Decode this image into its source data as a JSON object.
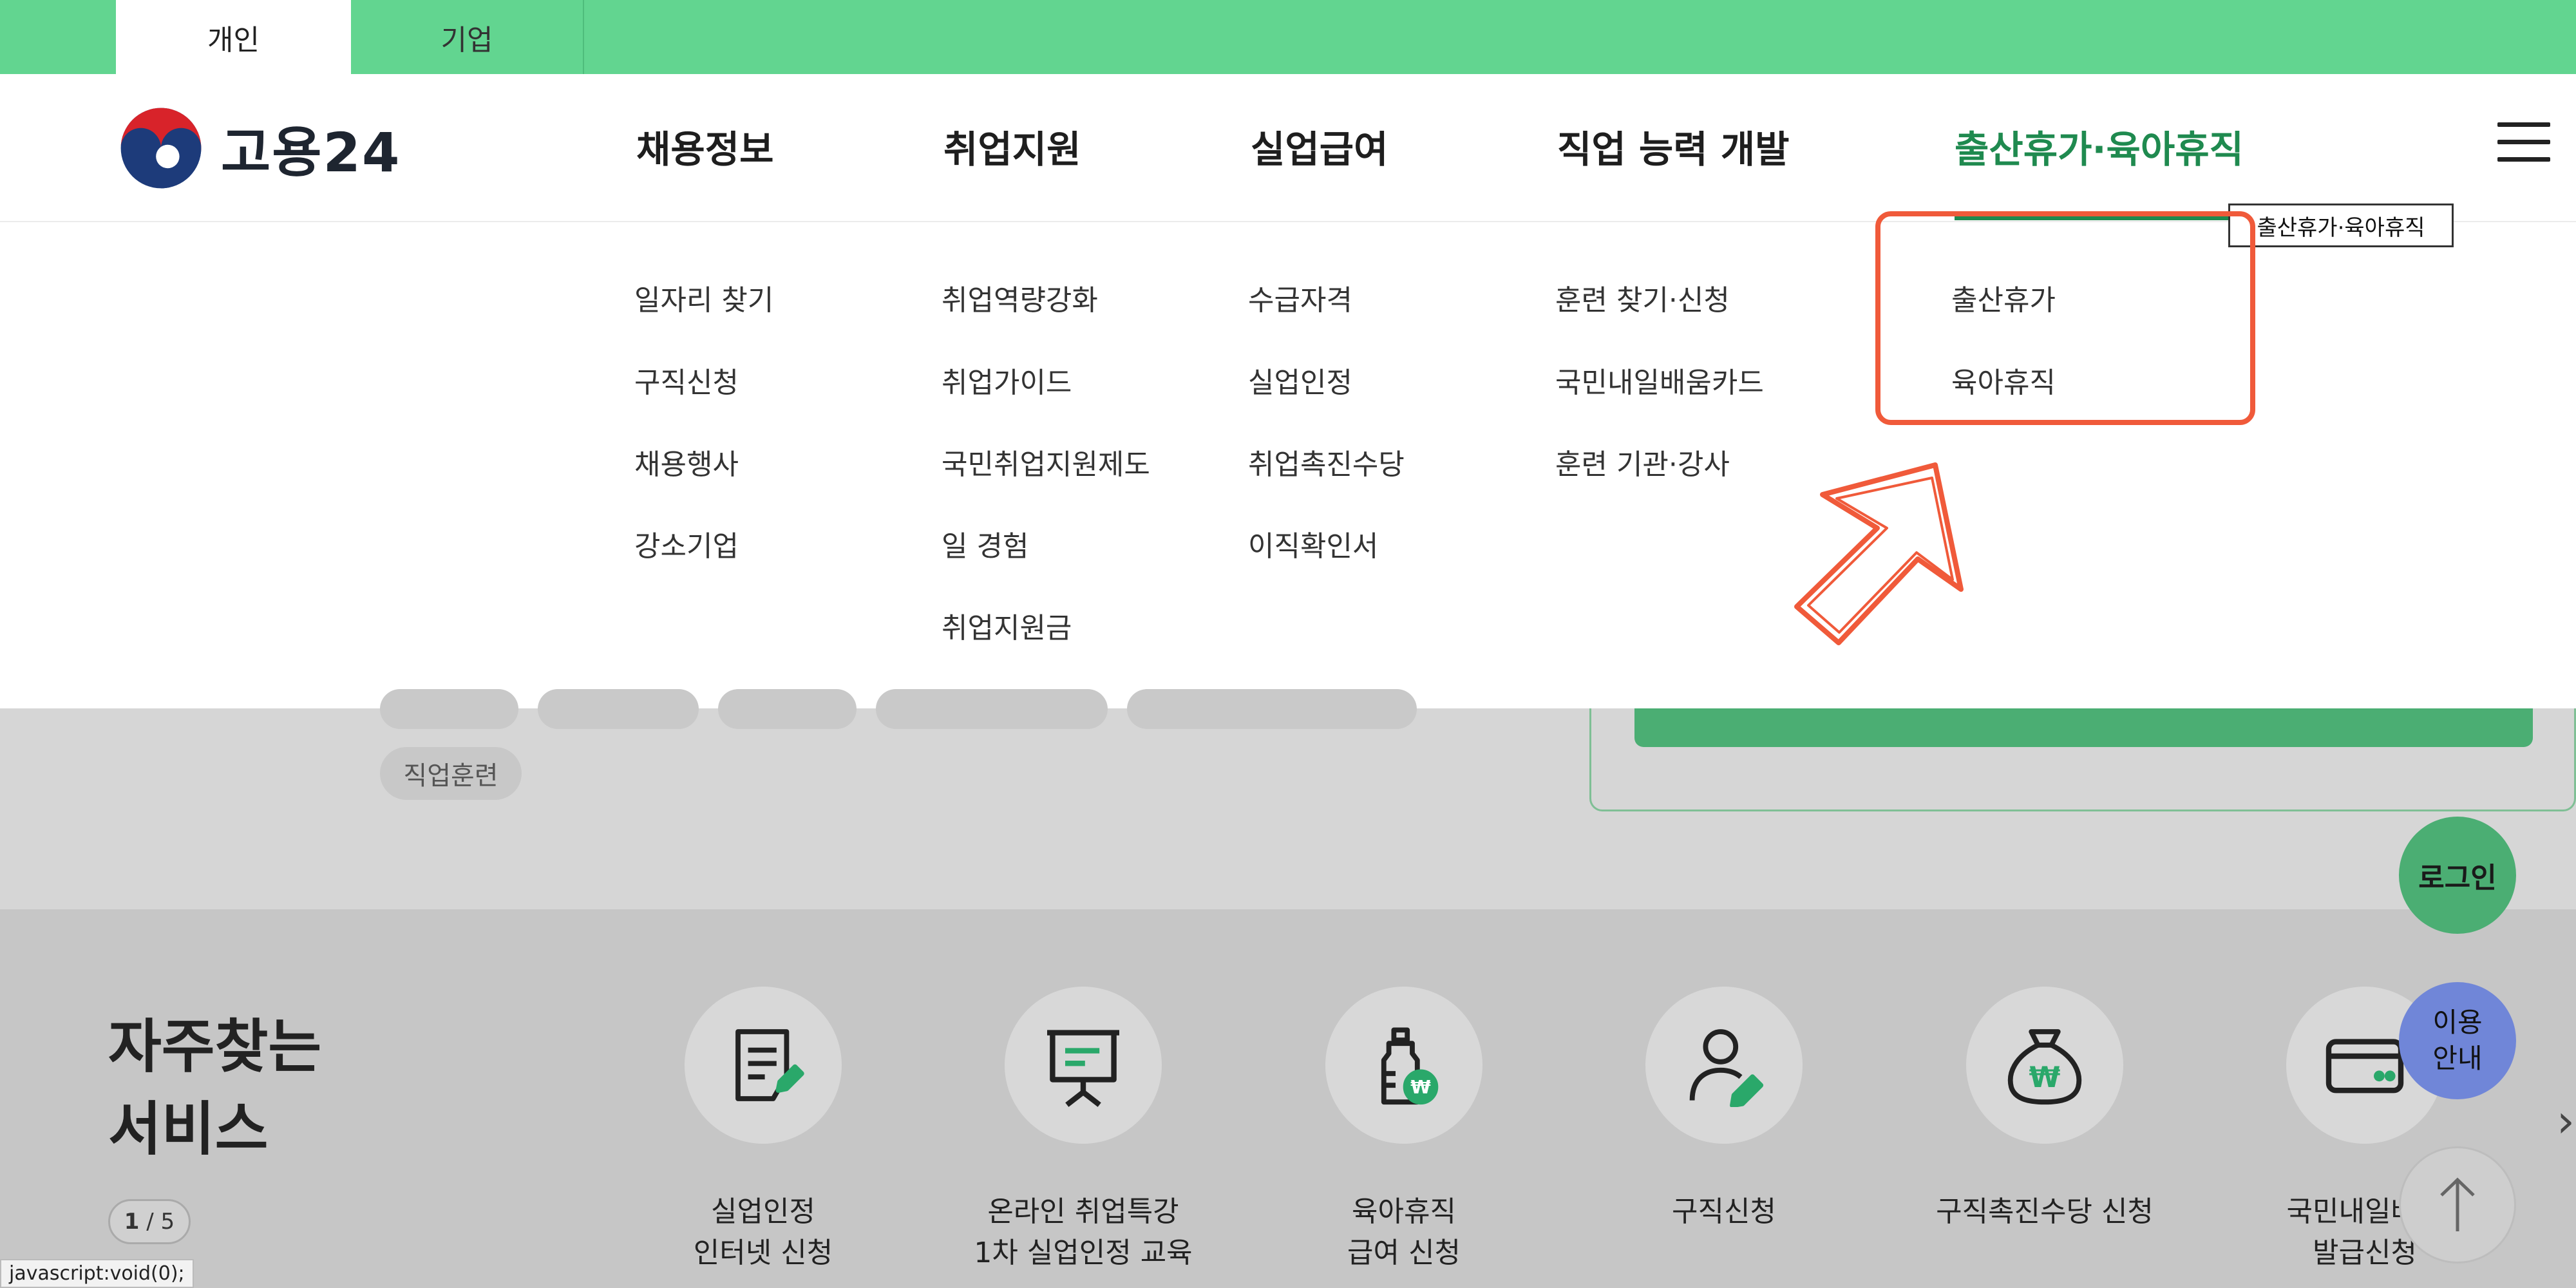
{
  "audience_tabs": {
    "personal": "개인",
    "corporate": "기업"
  },
  "logo": {
    "text": "고용24"
  },
  "gnb": [
    {
      "label": "채용정보"
    },
    {
      "label": "취업지원"
    },
    {
      "label": "실업급여"
    },
    {
      "label": "직업 능력 개발"
    },
    {
      "label": "출산휴가·육아휴직"
    }
  ],
  "tooltip": "출산휴가·육아휴직",
  "submenu": {
    "jobs": [
      "일자리 찾기",
      "구직신청",
      "채용행사",
      "강소기업"
    ],
    "support": [
      "취업역량강화",
      "취업가이드",
      "국민취업지원제도",
      "일 경험",
      "취업지원금"
    ],
    "unemployment": [
      "수급자격",
      "실업인정",
      "취업촉진수당",
      "이직확인서"
    ],
    "training": [
      "훈련 찾기·신청",
      "국민내일배움카드",
      "훈련 기관·강사"
    ],
    "parental": [
      "출산휴가",
      "육아휴직"
    ]
  },
  "background": {
    "chip_training": "직업훈련",
    "login_label": "로그인"
  },
  "frequent": {
    "title_line1": "자주찾는",
    "title_line2": "서비스",
    "pager_current": "1",
    "pager_total": "/ 5",
    "services": [
      {
        "line1": "실업인정",
        "line2": "인터넷 신청",
        "icon": "document-pen-icon"
      },
      {
        "line1": "온라인 취업특강",
        "line2": "1차 실업인정 교육",
        "icon": "presentation-board-icon"
      },
      {
        "line1": "육아휴직",
        "line2": "급여 신청",
        "icon": "baby-bottle-won-icon"
      },
      {
        "line1": "구직신청",
        "line2": "",
        "icon": "person-pen-icon"
      },
      {
        "line1": "구직촉진수당 신청",
        "line2": "",
        "icon": "money-bag-won-icon"
      },
      {
        "line1": "국민내일배움",
        "line2": "발급신청",
        "icon": "card-icon"
      }
    ]
  },
  "floating": {
    "login": "로그인",
    "guide_line1": "이용",
    "guide_line2": "안내"
  },
  "status_url": "javascript:void(0);",
  "colors": {
    "brand_green": "#62d590",
    "active_green": "#1f8a4f",
    "highlight_red": "#f05a3a",
    "guide_blue": "#7086d8"
  }
}
